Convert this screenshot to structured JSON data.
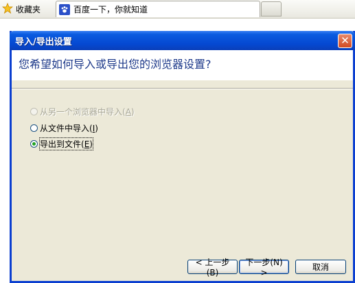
{
  "toolbar": {
    "favorites_label": "收藏夹",
    "tab_label": "百度一下，你就知道"
  },
  "dialog": {
    "title": "导入/导出设置",
    "question": "您希望如何导入或导出您的浏览器设置?",
    "options": [
      {
        "text": "从另一个浏览器中导入",
        "accel": "(A)",
        "accel_key": "A",
        "enabled": false,
        "selected": false
      },
      {
        "text": "从文件中导入",
        "accel": "(I)",
        "accel_key": "I",
        "enabled": true,
        "selected": false
      },
      {
        "text": "导出到文件",
        "accel": "(E)",
        "accel_key": "E",
        "enabled": true,
        "selected": true
      }
    ],
    "buttons": {
      "back": "< 上一步(B)",
      "next": "下一步(N) >",
      "cancel": "取消"
    }
  },
  "colors": {
    "titlebar": "#0548d1",
    "dialog_bg": "#ece9d8",
    "question_text": "#1e3a8a",
    "radio_dot": "#21a121",
    "close_button": "#d34a21"
  }
}
